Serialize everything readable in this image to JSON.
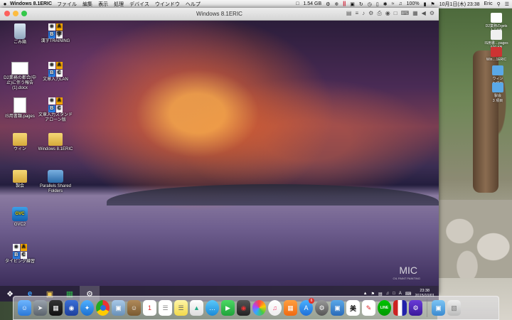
{
  "menubar": {
    "apple": "",
    "app_name": "Windows 8.1ERIC",
    "menus": [
      "ファイル",
      "編集",
      "表示",
      "処理",
      "デバイス",
      "ウインドウ",
      "ヘルプ"
    ],
    "memory": "1.54 GB",
    "battery": "100%",
    "datetime": "10月1日(木) 23:38",
    "user": "Eric"
  },
  "vm_window": {
    "title": "Windows 8.1ERIC"
  },
  "windows_desktop": {
    "icons": [
      {
        "label": "ごみ箱",
        "glyph": "recycle-bin-icon"
      },
      {
        "label": "漢字TRAINING",
        "glyph": "abc-icon"
      },
      {
        "label": "D2業務の都合(中止)に伴う報告(1).docx",
        "glyph": "document-icon"
      },
      {
        "label": "文章入力LAN",
        "glyph": "abc-icon"
      },
      {
        "label": "IS用書類.pages",
        "glyph": "document-icon"
      },
      {
        "label": "文章入力スタンドアローン版",
        "glyph": "abc-icon"
      },
      {
        "label": "ウィン",
        "glyph": "folder-icon"
      },
      {
        "label": "Windows 8.1ERIC",
        "glyph": "folder-icon"
      },
      {
        "label": "製会",
        "glyph": "folder-icon"
      },
      {
        "label": "Parallels Shared Folders",
        "glyph": "network-folder-icon"
      },
      {
        "label": "GVC2",
        "glyph": "gvc-icon"
      },
      {
        "label": "タイピング練習",
        "glyph": "abc-icon"
      }
    ],
    "watermark": "MIC",
    "watermark_sub": "OIL PAINT PAINTING"
  },
  "taskbar": {
    "clock_time": "23:38",
    "clock_date": "2015/10/01",
    "ime": "A"
  },
  "mac_desktop": {
    "icons": [
      {
        "label": "D2業務のgets",
        "sub": "1.7 MB"
      },
      {
        "label": "IS用書…pages",
        "sub": "920 KB"
      },
      {
        "label": "Win…1ERIC",
        "sub": ""
      },
      {
        "label": "ウィン",
        "sub": "2 項目"
      },
      {
        "label": "製会",
        "sub": "3 項目"
      }
    ]
  },
  "dock": {
    "badge_appstore": "6"
  },
  "colors": {
    "close": "#fc605c",
    "minimize": "#fdbc40",
    "zoom": "#34c84a"
  }
}
